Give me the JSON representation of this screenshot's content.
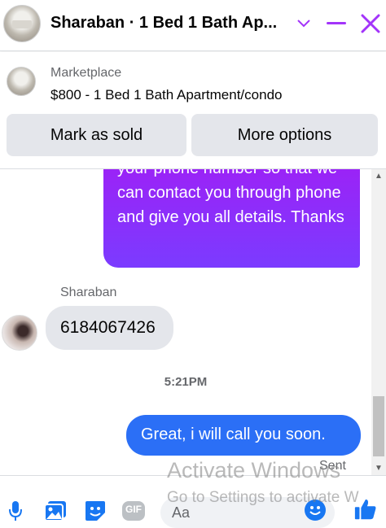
{
  "header": {
    "title": "Sharaban · 1 Bed 1 Bath Ap...",
    "icons": [
      "chevron-down-icon",
      "minimize-icon",
      "close-icon"
    ],
    "accent_color": "#a334fa"
  },
  "marketplace": {
    "label": "Marketplace",
    "listing_title": "$800 - 1 Bed 1 Bath Apartment/condo",
    "mark_sold_label": "Mark as sold",
    "more_options_label": "More options"
  },
  "chat": {
    "outgoing_message": "your phone number so that we can contact you through phone and give you all details. Thanks",
    "sender_name": "Sharaban",
    "incoming_message": "6184067426",
    "timestamp": "5:21PM",
    "outgoing_message_2": "Great, i will call you soon.",
    "sent_status": "Sent"
  },
  "composer": {
    "placeholder": "Aa",
    "icons": [
      "microphone-icon",
      "image-icon",
      "sticker-icon",
      "gif-icon",
      "emoji-icon",
      "thumbs-up-icon"
    ],
    "gif_label": "GIF"
  },
  "watermark": {
    "line1": "Activate Windows",
    "line2": "Go to Settings to activate W"
  },
  "colors": {
    "outgoing_gradient_top": "#a01ff5",
    "outgoing_gradient_bottom": "#7b3bff",
    "outgoing_blue": "#2b6ff6",
    "incoming_bg": "#e4e6eb",
    "icon_blue": "#1877f2"
  }
}
